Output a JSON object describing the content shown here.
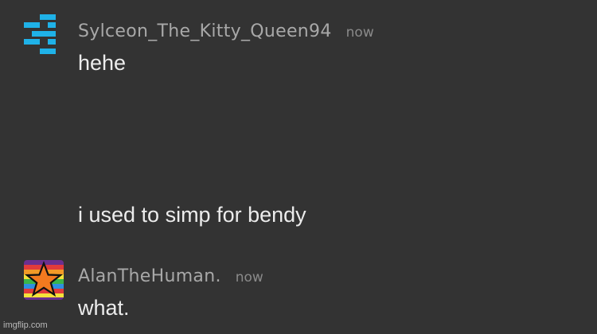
{
  "messages": [
    {
      "username": "Sylceon_The_Kitty_Queen94",
      "timestamp": "now",
      "lines": [
        "hehe",
        "i used to simp for bendy"
      ],
      "avatar_color": "#1fb2e8"
    },
    {
      "username": "AlanTheHuman.",
      "timestamp": "now",
      "lines": [
        "what."
      ],
      "avatar_colors": [
        "#6b2f8f",
        "#e23b3b",
        "#f39a27",
        "#f4e13a",
        "#3bb54a",
        "#2f8fe0",
        "#6b2f8f"
      ],
      "star_color": "#f37a1f"
    }
  ],
  "watermark": "imgflip.com"
}
